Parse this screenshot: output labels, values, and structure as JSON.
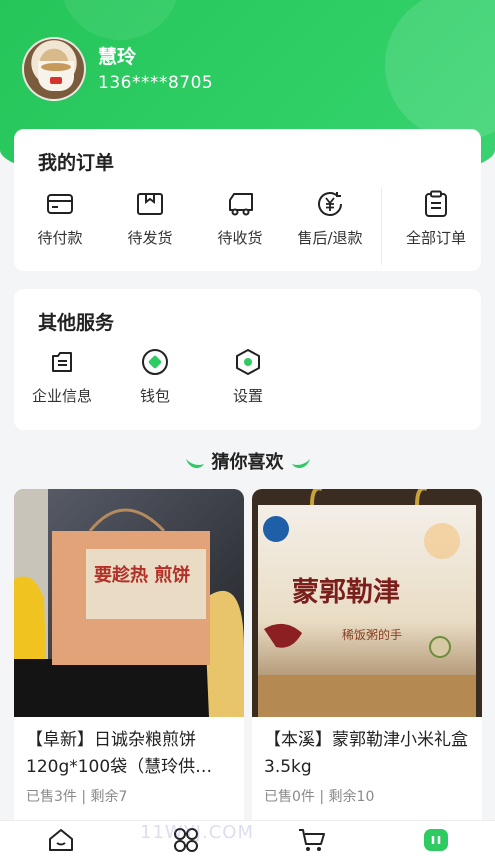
{
  "profile": {
    "name": "慧玲",
    "phone": "136****8705"
  },
  "orders": {
    "title": "我的订单",
    "items": [
      {
        "label": "待付款",
        "icon": "card-icon"
      },
      {
        "label": "待发货",
        "icon": "box-icon"
      },
      {
        "label": "待收货",
        "icon": "truck-icon"
      },
      {
        "label": "售后/退款",
        "icon": "yuan-refund-icon"
      },
      {
        "label": "全部订单",
        "icon": "clipboard-icon"
      }
    ]
  },
  "services": {
    "title": "其他服务",
    "items": [
      {
        "label": "企业信息",
        "icon": "company-info-icon"
      },
      {
        "label": "钱包",
        "icon": "wallet-icon"
      },
      {
        "label": "设置",
        "icon": "settings-icon"
      }
    ]
  },
  "recommend": {
    "title": "猜你喜欢"
  },
  "products": [
    {
      "title": "【阜新】日诚杂粮煎饼120g*100袋（慧玲供…",
      "sold": "已售3件",
      "stock": "剩余7",
      "image_text": "要趁热 煎饼"
    },
    {
      "title": "【本溪】蒙郭勒津小米礼盒3.5kg",
      "sold": "已售0件",
      "stock": "剩余10",
      "image_text": "蒙郭勒津",
      "image_subtext": "稀饭粥的手"
    }
  ],
  "tabbar": {
    "items": [
      {
        "icon": "home-icon"
      },
      {
        "icon": "category-icon"
      },
      {
        "icon": "cart-icon"
      },
      {
        "icon": "profile-icon",
        "active": true
      }
    ],
    "watermark": "11WYJ.COM"
  },
  "colors": {
    "brand_green": "#2ecb63",
    "text_dark": "#222222",
    "text_muted": "#8a8a8a"
  }
}
